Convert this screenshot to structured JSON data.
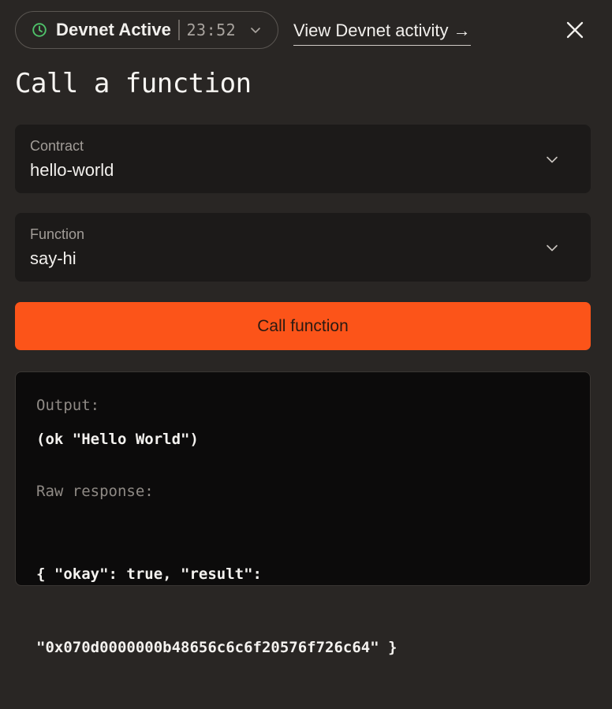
{
  "header": {
    "status_label": "Devnet Active",
    "timer": "23:52",
    "activity_link": "View Devnet activity →"
  },
  "page": {
    "title": "Call a function"
  },
  "form": {
    "contract": {
      "label": "Contract",
      "value": "hello-world"
    },
    "function": {
      "label": "Function",
      "value": "say-hi"
    },
    "submit_label": "Call function"
  },
  "result": {
    "output_label": "Output:",
    "output_value": "(ok \"Hello World\")",
    "raw_label": "Raw response:",
    "raw_line1": "{ \"okay\": true, \"result\":",
    "raw_line2": "\"0x070d0000000b48656c6c6f20576f726c64\" }"
  },
  "colors": {
    "background": "#292624",
    "field_bg": "#1c1a19",
    "accent": "#fc5419",
    "status_green": "#4fc26a",
    "output_bg": "#0c0b0b"
  },
  "icons": {
    "status": "clock-icon",
    "dropdown": "chevron-down-icon",
    "close": "close-icon"
  }
}
